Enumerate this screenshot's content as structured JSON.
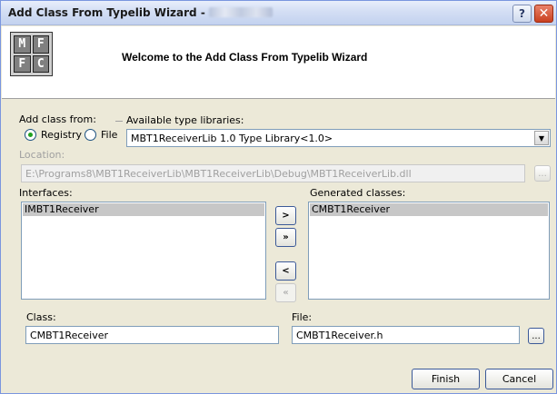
{
  "window": {
    "title": "Add Class From Typelib Wizard -",
    "help_label": "?",
    "close_label": "✕"
  },
  "header": {
    "logo_cells": [
      "M",
      "F",
      "F",
      "C"
    ],
    "welcome": "Welcome to the Add Class From Typelib Wizard"
  },
  "form": {
    "add_class_from_label": "Add class from:",
    "registry_label": "Registry",
    "file_label": "File",
    "available_libraries_label": "Available type libraries:",
    "library_selected": "MBT1ReceiverLib 1.0 Type Library<1.0>",
    "location_label": "Location:",
    "location_value": "E:\\Programs8\\MBT1ReceiverLib\\MBT1ReceiverLib\\Debug\\MBT1ReceiverLib.dll",
    "interfaces_label": "Interfaces:",
    "interfaces": [
      "IMBT1Receiver"
    ],
    "generated_label": "Generated classes:",
    "generated": [
      "CMBT1Receiver"
    ],
    "class_label": "Class:",
    "class_value": "CMBT1Receiver",
    "file_field_label": "File:",
    "file_value": "CMBT1Receiver.h",
    "browse_label": "...",
    "move_one_right": ">",
    "move_all_right": "»",
    "move_one_left": "<",
    "move_all_left": "«"
  },
  "footer": {
    "finish_label": "Finish",
    "cancel_label": "Cancel"
  }
}
